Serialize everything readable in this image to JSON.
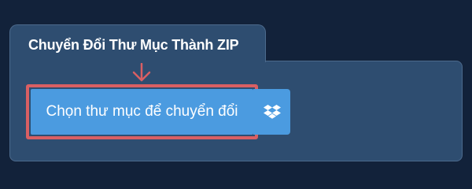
{
  "converter": {
    "tab_title": "Chuyển Đổi Thư Mục Thành ZIP",
    "choose_folder_label": "Chọn thư mục để chuyển đổi",
    "cloud_icon": "dropbox-icon"
  },
  "colors": {
    "page_background": "#12223a",
    "panel_background": "#2e4d70",
    "button_blue": "#4b9be0",
    "highlight_red": "#d95f63"
  }
}
